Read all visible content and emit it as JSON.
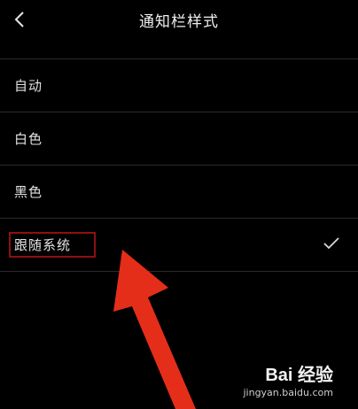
{
  "header": {
    "title": "通知栏样式",
    "back_icon": "chevron-left-icon"
  },
  "options": [
    {
      "label": "自动",
      "selected": false
    },
    {
      "label": "白色",
      "selected": false
    },
    {
      "label": "黑色",
      "selected": false
    },
    {
      "label": "跟随系统",
      "selected": true
    }
  ],
  "selected_icon": "checkmark-icon",
  "annotation": {
    "color": "#e52e1a",
    "box_color": "#8e1010"
  },
  "watermark": {
    "brand": "Bai 经验",
    "url": "jingyan.baidu.com"
  }
}
